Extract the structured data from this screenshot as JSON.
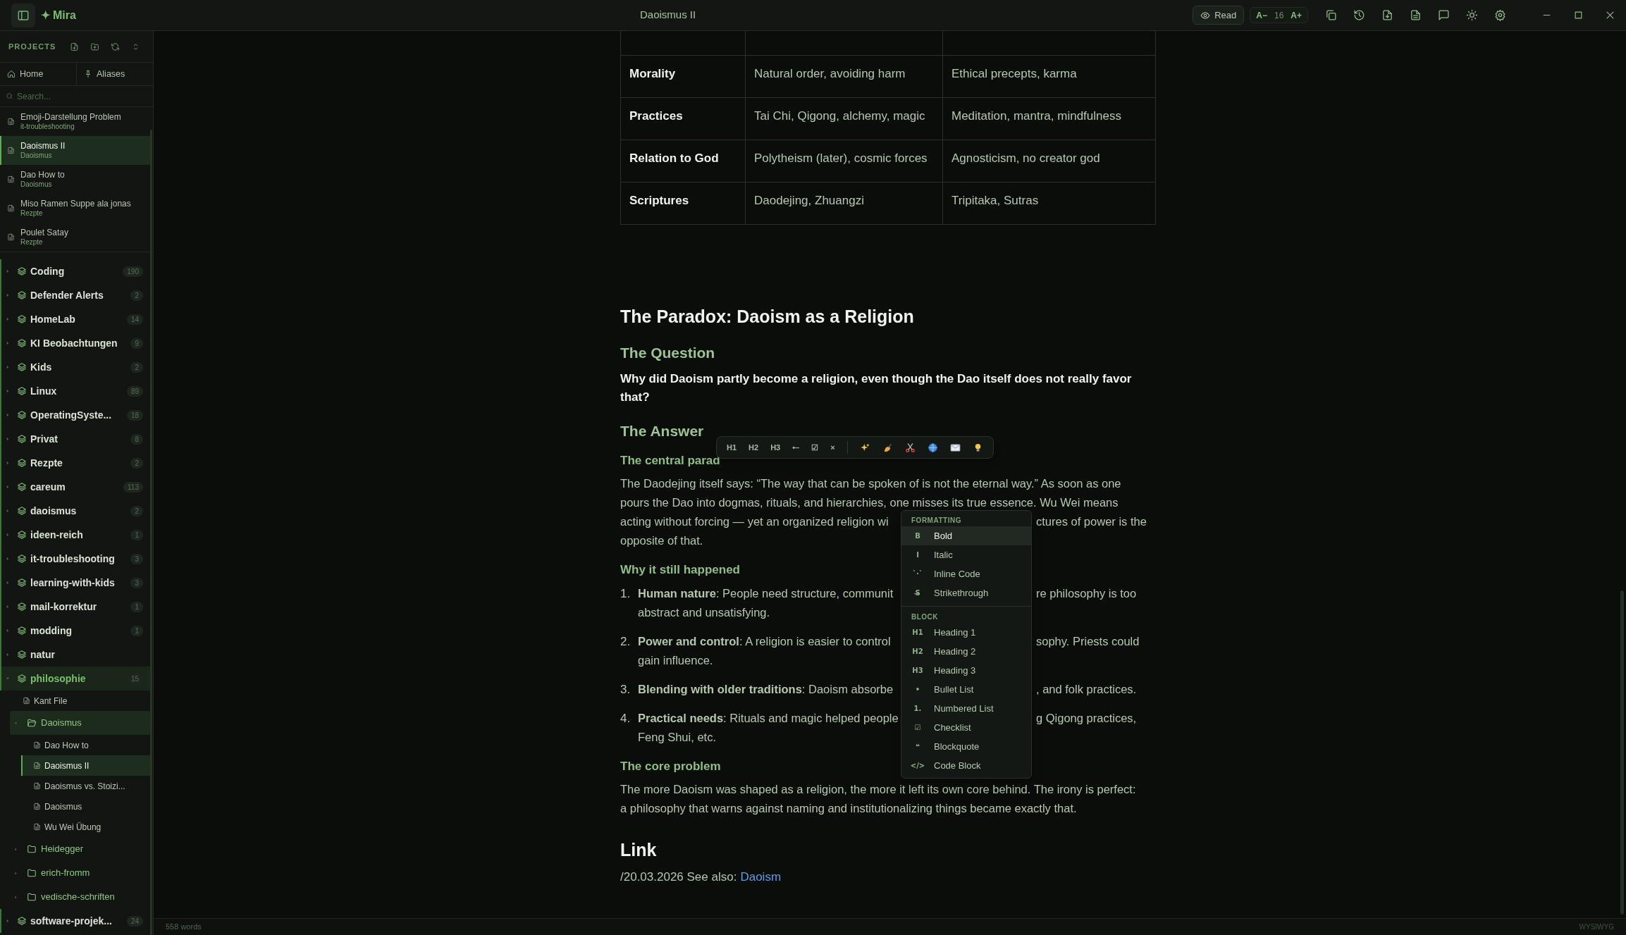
{
  "window": {
    "title": "Daoismus II"
  },
  "app": {
    "mark": "✦",
    "name": "Mira"
  },
  "toolbar": {
    "read_label": "Read",
    "font_decrease": "A−",
    "font_size": "16",
    "font_increase": "A+"
  },
  "sidebar": {
    "heading": "PROJECTS",
    "tabs": [
      {
        "kind": "home",
        "label": "Home"
      },
      {
        "kind": "aliases",
        "label": "Aliases"
      }
    ],
    "search": {
      "placeholder": "Search..."
    },
    "recent": [
      {
        "title": "Emoji-Darstellung Problem",
        "project": "it-troubleshooting",
        "selected": false
      },
      {
        "title": "Daoismus II",
        "project": "Daoismus",
        "selected": true
      },
      {
        "title": "Dao How to",
        "project": "Daoismus",
        "selected": false
      },
      {
        "title": "Miso Ramen Suppe ala jonas",
        "project": "Rezpte",
        "selected": false
      },
      {
        "title": "Poulet Satay",
        "project": "Rezpte",
        "selected": false
      }
    ],
    "tree": [
      {
        "kind": "project",
        "name": "Coding",
        "count": "190",
        "expanded": false
      },
      {
        "kind": "project",
        "name": "Defender Alerts",
        "count": "2",
        "expanded": false
      },
      {
        "kind": "project",
        "name": "HomeLab",
        "count": "14",
        "expanded": false
      },
      {
        "kind": "project",
        "name": "KI Beobachtungen",
        "count": "9",
        "expanded": false
      },
      {
        "kind": "project",
        "name": "Kids",
        "count": "2",
        "expanded": false
      },
      {
        "kind": "project",
        "name": "Linux",
        "count": "89",
        "expanded": false
      },
      {
        "kind": "project",
        "name": "OperatingSyste...",
        "count": "18",
        "expanded": false
      },
      {
        "kind": "project",
        "name": "Privat",
        "count": "8",
        "expanded": false
      },
      {
        "kind": "project",
        "name": "Rezpte",
        "count": "2",
        "expanded": false
      },
      {
        "kind": "project",
        "name": "careum",
        "count": "113",
        "expanded": false
      },
      {
        "kind": "project",
        "name": "daoismus",
        "count": "2",
        "expanded": false
      },
      {
        "kind": "project",
        "name": "ideen-reich",
        "count": "1",
        "expanded": false
      },
      {
        "kind": "project",
        "name": "it-troubleshooting",
        "count": "3",
        "expanded": false
      },
      {
        "kind": "project",
        "name": "learning-with-kids",
        "count": "3",
        "expanded": false
      },
      {
        "kind": "project",
        "name": "mail-korrektur",
        "count": "1",
        "expanded": false
      },
      {
        "kind": "project",
        "name": "modding",
        "count": "1",
        "expanded": false
      },
      {
        "kind": "project",
        "name": "natur",
        "expanded": false
      },
      {
        "kind": "project",
        "name": "philosophie",
        "count": "15",
        "expanded": true,
        "children": [
          {
            "kind": "file",
            "name": "Kant File",
            "selected": false
          },
          {
            "kind": "folder",
            "name": "Daoismus",
            "expanded": true,
            "children": [
              {
                "kind": "file",
                "name": "Dao How to",
                "selected": false
              },
              {
                "kind": "file",
                "name": "Daoismus II",
                "selected": true
              },
              {
                "kind": "file",
                "name": "Daoismus vs. Stoizi...",
                "selected": false
              },
              {
                "kind": "file",
                "name": "Daoismus",
                "selected": false
              },
              {
                "kind": "file",
                "name": "Wu Wei Übung",
                "selected": false
              }
            ]
          },
          {
            "kind": "folder",
            "name": "Heidegger",
            "expanded": false
          },
          {
            "kind": "folder",
            "name": "erich-fromm",
            "expanded": false
          },
          {
            "kind": "folder",
            "name": "vedische-schriften",
            "expanded": false
          }
        ]
      },
      {
        "kind": "project",
        "name": "software-projek...",
        "count": "24",
        "expanded": false
      }
    ]
  },
  "document": {
    "table": {
      "rows": [
        [
          "Morality",
          "Natural order, avoiding harm",
          "Ethical precepts, karma"
        ],
        [
          "Practices",
          "Tai Chi, Qigong, alchemy, magic",
          "Meditation, mantra, mindfulness"
        ],
        [
          "Relation to God",
          "Polytheism (later), cosmic forces",
          "Agnosticism, no creator god"
        ],
        [
          "Scriptures",
          "Daodejing, Zhuangzi",
          "Tripitaka, Sutras"
        ]
      ]
    },
    "blocks": [
      {
        "kind": "h1",
        "text": "The Paradox: Daoism as a Religion"
      },
      {
        "kind": "h2",
        "text": "The Question"
      },
      {
        "kind": "strong",
        "lines": [
          "Why did Daoism partly become a religion, even though the Dao itself does not really favor",
          "that?"
        ]
      },
      {
        "kind": "h2",
        "text": "The Answer"
      },
      {
        "kind": "h3",
        "text": "The central parad"
      },
      {
        "kind": "paragraph",
        "lines": [
          {
            "text": "The Daodejing itself says: “The way that can be spoken of is not the eternal way.” As soon as one"
          },
          {
            "text": "pours the Dao into dogmas, rituals, and hierarchies, one misses its true essence. Wu Wei means"
          },
          {
            "left": "acting without forcing — yet an organized religion wi",
            "right": "ctures of power is the"
          },
          {
            "text": "opposite of that."
          }
        ]
      },
      {
        "kind": "h3",
        "text": "Why it still happened"
      },
      {
        "kind": "list",
        "items": [
          {
            "number": "1.",
            "lines": [
              {
                "left": "**Human nature**: People need structure, communit",
                "right": "re philosophy is too"
              },
              {
                "text": "abstract and unsatisfying."
              }
            ]
          },
          {
            "number": "2.",
            "lines": [
              {
                "left": "**Power and control**: A religion is easier to control",
                "right": "sophy. Priests could"
              },
              {
                "text": "gain influence."
              }
            ]
          },
          {
            "number": "3.",
            "lines": [
              {
                "left": "**Blending with older traditions**: Daoism absorbe",
                "right": ", and folk practices."
              }
            ]
          },
          {
            "number": "4.",
            "lines": [
              {
                "left": "**Practical needs**: Rituals and magic helped people",
                "right": "g Qigong practices,"
              },
              {
                "text": "Feng Shui, etc."
              }
            ]
          }
        ]
      },
      {
        "kind": "h3",
        "text": "The core problem"
      },
      {
        "kind": "paragraph",
        "lines": [
          {
            "text": "The more Daoism was shaped as a religion, the more it left its own core behind. The irony is perfect:"
          },
          {
            "text": "a philosophy that warns against naming and institutionalizing things became exactly that."
          }
        ]
      },
      {
        "kind": "h1",
        "text": "Link"
      },
      {
        "kind": "link_line",
        "text": "/20.03.2026 See also:",
        "link": "Daoism"
      }
    ]
  },
  "format_toolbar": {
    "buttons": [
      "H1",
      "H2",
      "H3",
      "•–",
      "☑",
      "×"
    ]
  },
  "format_menu": {
    "sections": [
      {
        "heading": "FORMATTING",
        "items": [
          {
            "glyph": "B",
            "label": "Bold",
            "selected": true
          },
          {
            "glyph": "I",
            "label": "Italic",
            "selected": false
          },
          {
            "glyph": "`·`",
            "label": "Inline Code",
            "selected": false
          },
          {
            "glyph": "S̶",
            "label": "Strikethrough",
            "selected": false
          }
        ]
      },
      {
        "heading": "BLOCK",
        "items": [
          {
            "glyph": "H1",
            "label": "Heading 1",
            "selected": false
          },
          {
            "glyph": "H2",
            "label": "Heading 2",
            "selected": false
          },
          {
            "glyph": "H3",
            "label": "Heading 3",
            "selected": false
          },
          {
            "glyph": "•",
            "label": "Bullet List",
            "selected": false
          },
          {
            "glyph": "1.",
            "label": "Numbered List",
            "selected": false
          },
          {
            "glyph": "☑",
            "label": "Checklist",
            "selected": false
          },
          {
            "glyph": "❝",
            "label": "Blockquote",
            "selected": false
          },
          {
            "glyph": "</>",
            "label": "Code Block",
            "selected": false
          }
        ]
      }
    ]
  },
  "status_bar": {
    "words": "558 words",
    "mode": "WYSIWYG"
  }
}
